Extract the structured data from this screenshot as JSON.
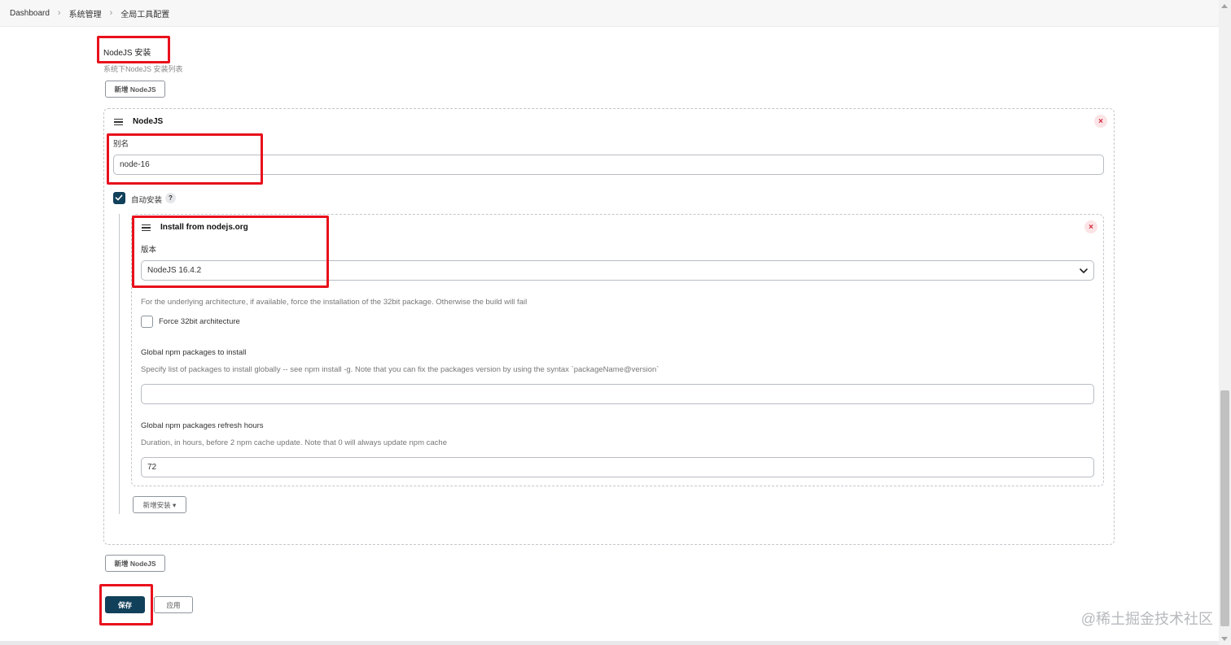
{
  "breadcrumb": [
    "Dashboard",
    "系统管理",
    "全局工具配置"
  ],
  "section": {
    "title": "NodeJS 安装",
    "description": "系统下NodeJS 安装列表",
    "add_button_label": "新增 NodeJS"
  },
  "installation": {
    "title": "NodeJS",
    "close_label": "×",
    "alias_label": "别名",
    "alias_value": "node-16",
    "auto_install_label": "自动安装",
    "auto_install_checked": true,
    "help_label": "?",
    "installer": {
      "title": "Install from nodejs.org",
      "close_label": "×",
      "version_label": "版本",
      "version_value": "NodeJS 16.4.2",
      "force32_help": "For the underlying architecture, if available, force the installation of the 32bit package. Otherwise the build will fail",
      "force32_label": "Force 32bit architecture",
      "force32_checked": false,
      "npm_packages_label": "Global npm packages to install",
      "npm_packages_help": "Specify list of packages to install globally -- see npm install -g. Note that you can fix the packages version by using the syntax `packageName@version`",
      "npm_packages_value": "",
      "refresh_label": "Global npm packages refresh hours",
      "refresh_help": "Duration, in hours, before 2 npm cache update. Note that 0 will always update npm cache",
      "refresh_value": "72"
    },
    "add_installer_label": "新增安装 ▾"
  },
  "footer": {
    "add_button_label": "新增 NodeJS",
    "save_label": "保存",
    "apply_label": "应用"
  },
  "watermark": "@稀土掘金技术社区",
  "colors": {
    "primary": "#11405a",
    "highlight": "#e8111c",
    "danger": "#d2263b"
  }
}
